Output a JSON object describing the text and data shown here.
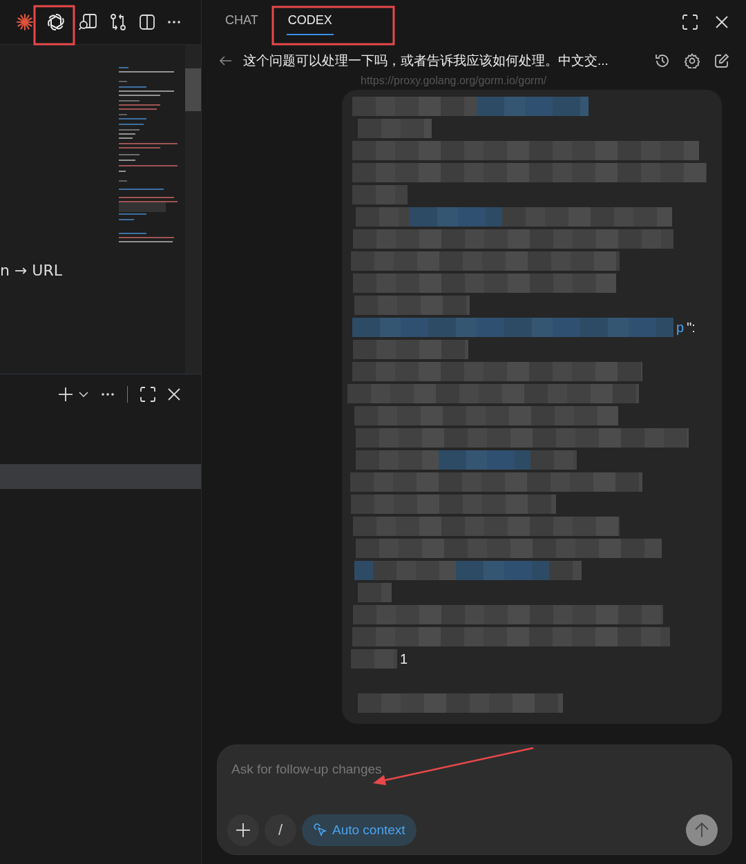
{
  "editor": {
    "visible_text": "n → URL"
  },
  "chat_panel": {
    "tabs": [
      {
        "label": "CHAT",
        "selected": false
      },
      {
        "label": "CODEX",
        "selected": true
      }
    ],
    "thread_title": "这个问题可以处理一下吗，或者告诉我应该如何处理。中文交...",
    "faded_url": "https://proxy.golang.org/gorm.io/gorm/",
    "message_fragments": [
      {
        "text": "p",
        "kind": "link"
      },
      {
        "text": "\":",
        "kind": "plain"
      },
      {
        "text": "1",
        "kind": "plain"
      }
    ]
  },
  "composer": {
    "placeholder": "Ask for follow-up changes",
    "slash_button": "/",
    "context_button": "Auto context"
  }
}
